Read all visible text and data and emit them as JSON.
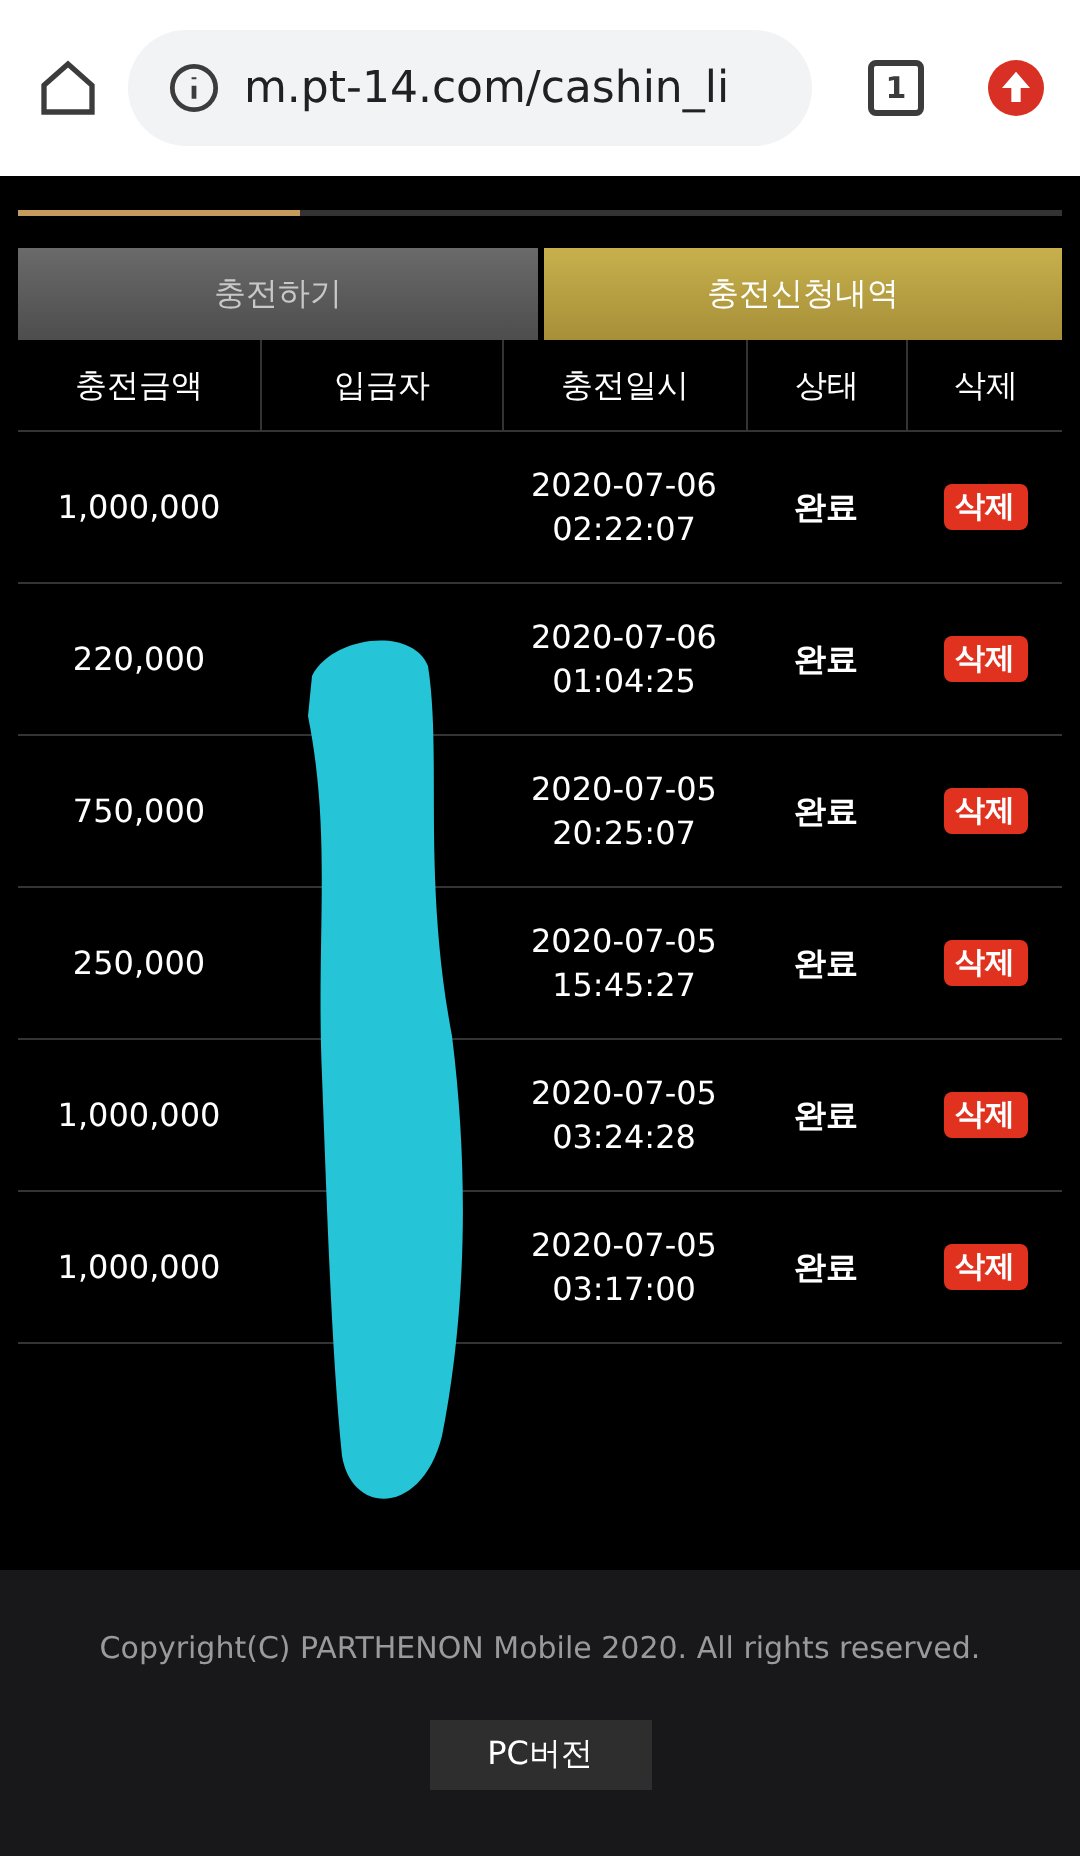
{
  "browser": {
    "url": "m.pt-14.com/cashin_li",
    "tab_count": "1"
  },
  "progress": {
    "level": 0.27
  },
  "tabs": [
    {
      "label": "충전하기",
      "selected": false
    },
    {
      "label": "충전신청내역",
      "selected": true
    }
  ],
  "table": {
    "columns": [
      "충전금액",
      "입금자",
      "충전일시",
      "상태",
      "삭제"
    ],
    "rows": [
      {
        "amount": "1,000,000",
        "date": "2020-07-06",
        "time": "02:22:07",
        "status": "완료",
        "action": "삭제"
      },
      {
        "amount": "220,000",
        "date": "2020-07-06",
        "time": "01:04:25",
        "status": "완료",
        "action": "삭제"
      },
      {
        "amount": "750,000",
        "date": "2020-07-05",
        "time": "20:25:07",
        "status": "완료",
        "action": "삭제"
      },
      {
        "amount": "250,000",
        "date": "2020-07-05",
        "time": "15:45:27",
        "status": "완료",
        "action": "삭제"
      },
      {
        "amount": "1,000,000",
        "date": "2020-07-05",
        "time": "03:24:28",
        "status": "완료",
        "action": "삭제"
      },
      {
        "amount": "1,000,000",
        "date": "2020-07-05",
        "time": "03:17:00",
        "status": "완료",
        "action": "삭제"
      }
    ]
  },
  "footer": {
    "copyright": "Copyright(C) PARTHENON Mobile 2020. All rights reserved.",
    "button": "PC버전"
  }
}
